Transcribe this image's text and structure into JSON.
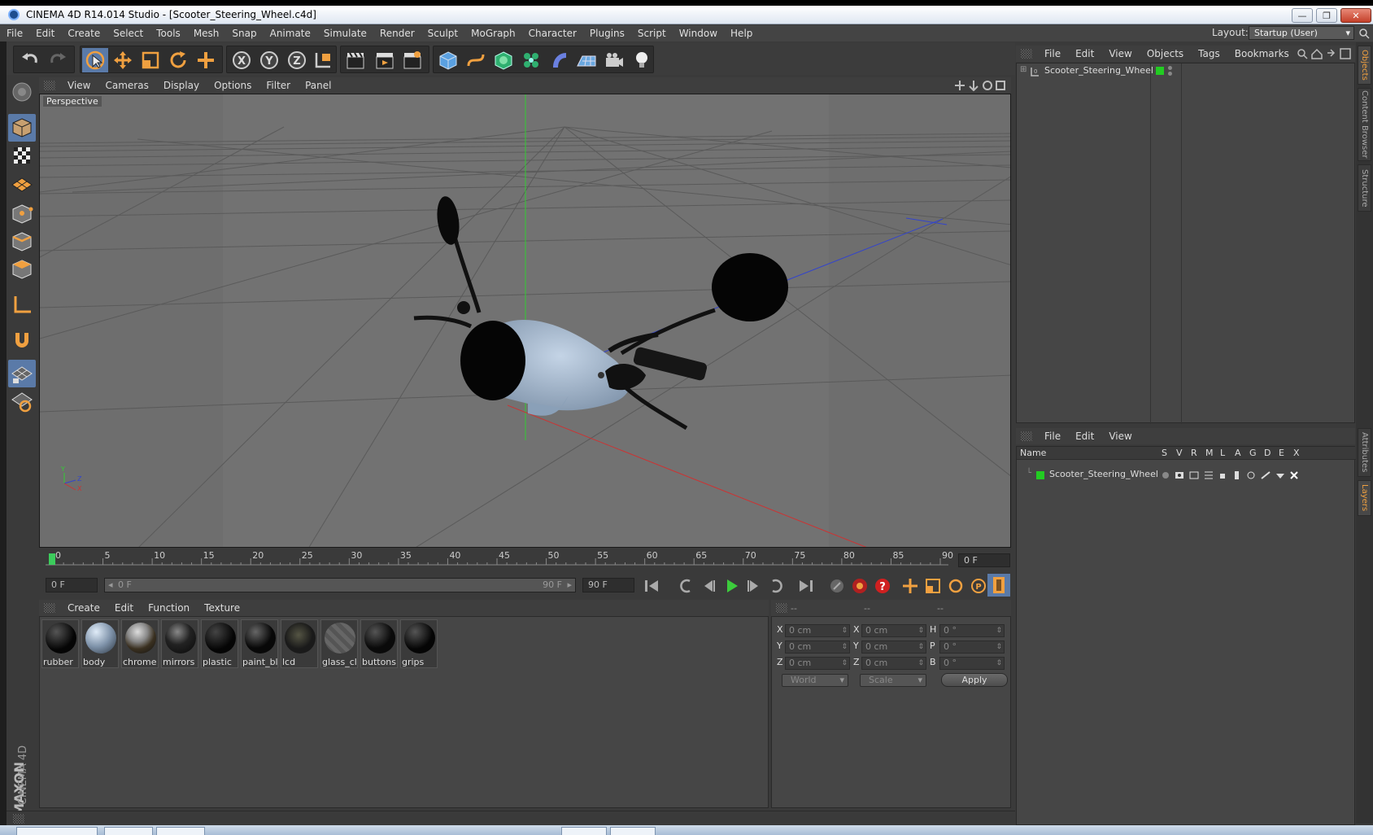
{
  "window": {
    "title": "CINEMA 4D R14.014 Studio - [Scooter_Steering_Wheel.c4d]",
    "min_label": "—",
    "max_label": "❐",
    "close_label": "✕"
  },
  "menubar": {
    "items": [
      "File",
      "Edit",
      "Create",
      "Select",
      "Tools",
      "Mesh",
      "Snap",
      "Animate",
      "Simulate",
      "Render",
      "Sculpt",
      "MoGraph",
      "Character",
      "Plugins",
      "Script",
      "Window",
      "Help"
    ],
    "layout_label": "Layout:",
    "layout_value": "Startup (User)"
  },
  "viewport": {
    "menu": [
      "View",
      "Cameras",
      "Display",
      "Options",
      "Filter",
      "Panel"
    ],
    "label": "Perspective",
    "axis_y": "Y",
    "axis_z": "Z",
    "axis_x": "X"
  },
  "timeline": {
    "ticks": [
      "0",
      "5",
      "10",
      "15",
      "20",
      "25",
      "30",
      "35",
      "40",
      "45",
      "50",
      "55",
      "60",
      "65",
      "70",
      "75",
      "80",
      "85",
      "90"
    ],
    "current_frame": "0 F"
  },
  "transport": {
    "start_field": "0 F",
    "range_start": "0 F",
    "range_end": "90 F",
    "end_field": "90 F"
  },
  "materials": {
    "menu": [
      "Create",
      "Edit",
      "Function",
      "Texture"
    ],
    "items": [
      {
        "label": "rubber"
      },
      {
        "label": "body"
      },
      {
        "label": "chrome"
      },
      {
        "label": "mirrors"
      },
      {
        "label": "plastic"
      },
      {
        "label": "paint_bl"
      },
      {
        "label": "lcd"
      },
      {
        "label": "glass_cl"
      },
      {
        "label": "buttons"
      },
      {
        "label": "grips"
      }
    ]
  },
  "coordinates": {
    "header": [
      "--",
      "--",
      "--"
    ],
    "rows": [
      {
        "l1": "X",
        "v1": "0 cm",
        "l2": "X",
        "v2": "0 cm",
        "l3": "H",
        "v3": "0 °"
      },
      {
        "l1": "Y",
        "v1": "0 cm",
        "l2": "Y",
        "v2": "0 cm",
        "l3": "P",
        "v3": "0 °"
      },
      {
        "l1": "Z",
        "v1": "0 cm",
        "l2": "Z",
        "v2": "0 cm",
        "l3": "B",
        "v3": "0 °"
      }
    ],
    "mode1": "World",
    "mode2": "Scale",
    "apply": "Apply"
  },
  "objects": {
    "menu": [
      "File",
      "Edit",
      "View",
      "Objects",
      "Tags",
      "Bookmarks"
    ],
    "items": [
      {
        "name": "Scooter_Steering_Wheel",
        "color": "#22cc22"
      }
    ]
  },
  "layers": {
    "menu": [
      "File",
      "Edit",
      "View"
    ],
    "header_name": "Name",
    "columns": [
      "S",
      "V",
      "R",
      "M",
      "L",
      "A",
      "G",
      "D",
      "E",
      "X"
    ],
    "items": [
      {
        "name": "Scooter_Steering_Wheel",
        "color": "#22cc22"
      }
    ]
  },
  "right_tabs": [
    "Objects",
    "Content Browser",
    "Structure",
    "Attributes",
    "Layers"
  ],
  "branding": {
    "line1": "MAXON",
    "line2": "CINEMA 4D"
  },
  "colors": {
    "accent_orange": "#f0a040",
    "selection_blue": "#5a7aa8",
    "object_green": "#22cc22",
    "x_axis": "#cc3333",
    "y_axis": "#33cc33",
    "z_axis": "#3344cc"
  }
}
